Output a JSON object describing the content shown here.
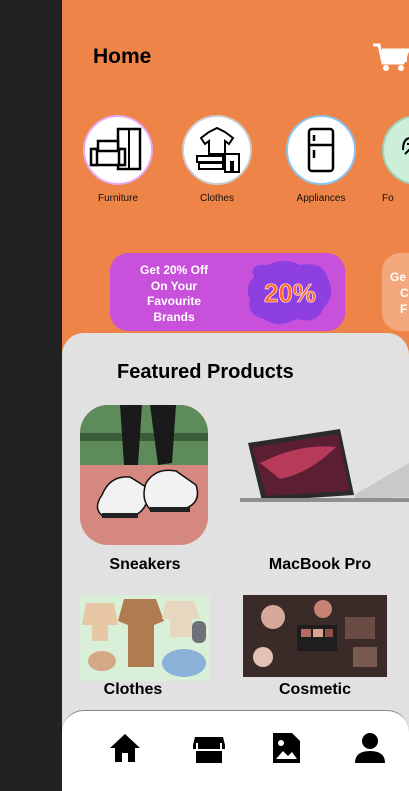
{
  "header": {
    "title": "Home"
  },
  "categories": [
    {
      "label": "Furniture",
      "icon": "armchair-cabinet-icon"
    },
    {
      "label": "Clothes",
      "icon": "clothes-hanger-icon"
    },
    {
      "label": "Appliances",
      "icon": "refrigerator-icon"
    },
    {
      "label": "Fo",
      "icon": "food-icon"
    }
  ],
  "promos": [
    {
      "lines": [
        "Get 20% Off",
        "On Your",
        "Favourite",
        "Brands"
      ],
      "badge": "20%"
    },
    {
      "lines": [
        "Ge",
        "C",
        "F"
      ]
    }
  ],
  "featured": {
    "title": "Featured Products",
    "products": [
      {
        "name": "Sneakers",
        "image": "sneakers-photo"
      },
      {
        "name": "MacBook Pro",
        "image": "macbook-photo"
      },
      {
        "name": "Clothes",
        "image": "baby-clothes-photo"
      },
      {
        "name": "Cosmetic",
        "image": "cosmetics-photo"
      }
    ]
  },
  "nav": [
    "home-icon",
    "store-icon",
    "gallery-icon",
    "profile-icon"
  ],
  "colors": {
    "background": "#EE8447",
    "sheet": "#E1E1E1",
    "promo": "#C851DB",
    "badge": "#FF6A2A"
  }
}
